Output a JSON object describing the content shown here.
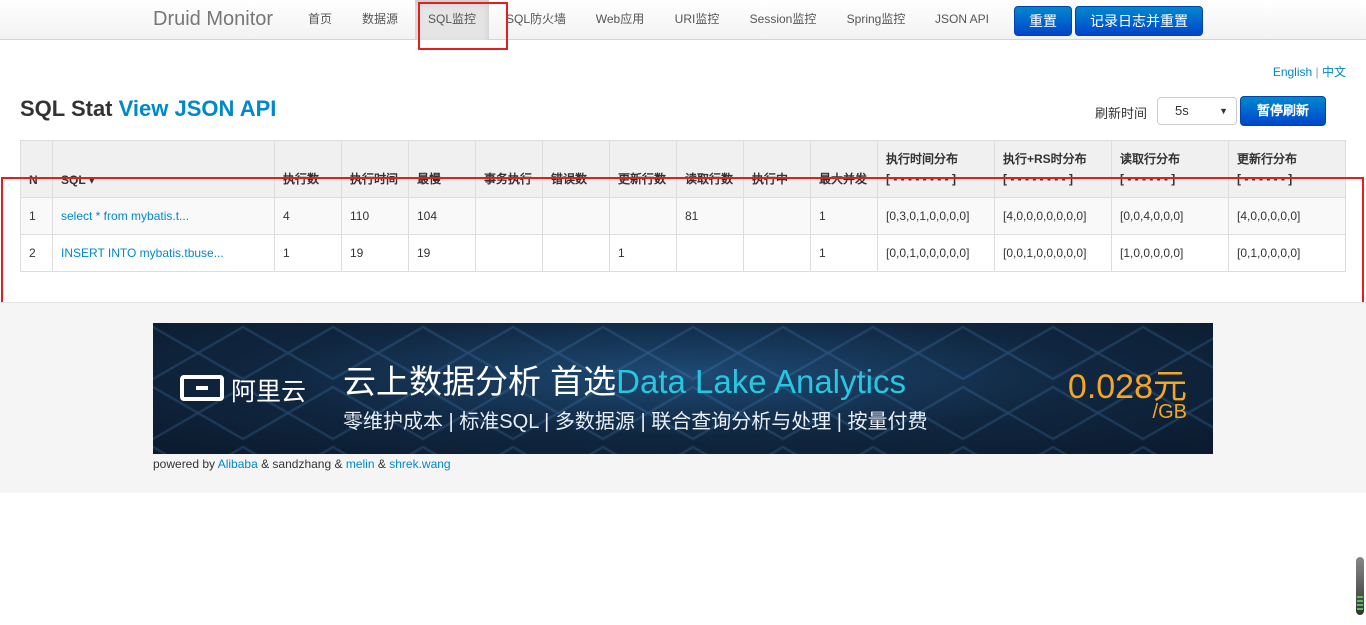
{
  "nav": {
    "brand": "Druid Monitor",
    "items": [
      "首页",
      "数据源",
      "SQL监控",
      "SQL防火墙",
      "Web应用",
      "URI监控",
      "Session监控",
      "Spring监控",
      "JSON API"
    ],
    "active": "SQL监控",
    "reset_button": "重置",
    "log_reset_button": "记录日志并重置"
  },
  "lang": {
    "english": "English",
    "separator": "|",
    "chinese": "中文"
  },
  "title": {
    "prefix": "SQL Stat",
    "link": "View JSON API"
  },
  "refresh": {
    "label": "刷新时间",
    "value": "5s",
    "pause_button": "暂停刷新"
  },
  "table": {
    "headers": [
      "N",
      "SQL ▾",
      "执行数",
      "执行时间",
      "最慢",
      "事务执行",
      "错误数",
      "更新行数",
      "读取行数",
      "执行中",
      "最大并发",
      "执行时间分布",
      "执行+RS时分布",
      "读取行分布",
      "更新行分布"
    ],
    "header_sub": [
      "[ - - - - - - - - ]",
      "[ - - - - - - - - ]",
      "[ - - - - - - ]",
      "[ - - - - - - ]"
    ],
    "rows": [
      [
        "1",
        "select * from mybatis.t...",
        "4",
        "110",
        "104",
        "",
        "",
        "",
        "81",
        "",
        "1",
        "[0,3,0,1,0,0,0,0]",
        "[4,0,0,0,0,0,0,0]",
        "[0,0,4,0,0,0]",
        "[4,0,0,0,0,0]"
      ],
      [
        "2",
        "INSERT INTO mybatis.tbuse...",
        "1",
        "19",
        "19",
        "",
        "",
        "1",
        "",
        "",
        "1",
        "[0,0,1,0,0,0,0,0]",
        "[0,0,1,0,0,0,0,0]",
        "[1,0,0,0,0,0]",
        "[0,1,0,0,0,0]"
      ]
    ]
  },
  "banner": {
    "logo_text": "阿里云",
    "title_prefix": "云上数据分析 首选",
    "title_accent": "Data Lake Analytics",
    "subtitle": "零维护成本 | 标准SQL | 多数据源 | 联合查询分析与处理 | 按量付费",
    "price": "0.028元",
    "unit": "/GB"
  },
  "footer": {
    "powered_by": "powered by",
    "alibaba": "Alibaba",
    "amp1": "& sandzhang &",
    "melin": "melin",
    "amp2": "&",
    "shrek": "shrek.wang"
  }
}
